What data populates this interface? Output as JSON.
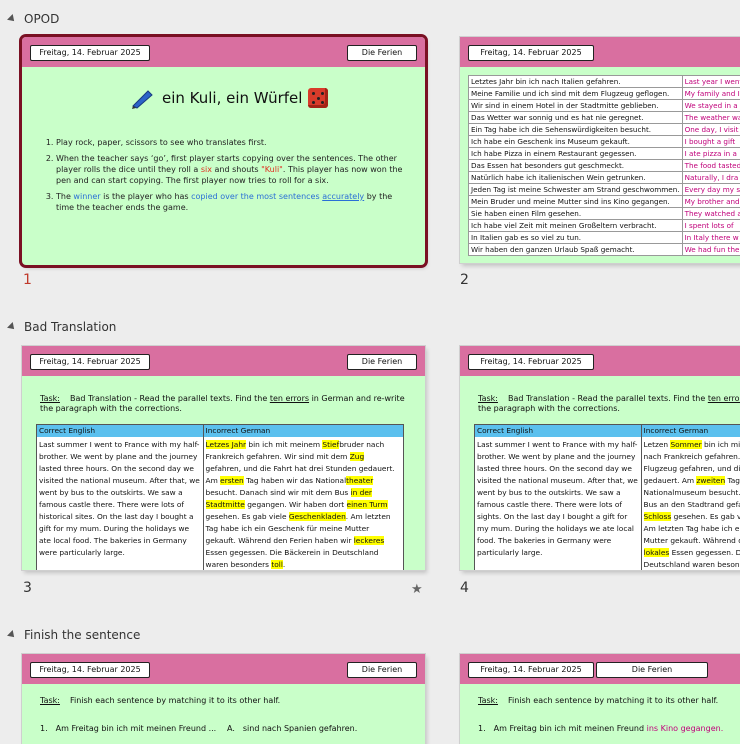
{
  "sections": [
    {
      "title": "OPOD"
    },
    {
      "title": "Bad Translation"
    },
    {
      "title": "Finish the sentence"
    }
  ],
  "header": {
    "date": "Freitag, 14. Februar 2025",
    "topic": "Die Ferien"
  },
  "slide1": {
    "number": "1",
    "title": "ein Kuli, ein Würfel",
    "rule1": "Play rock, paper, scissors to see who translates first.",
    "rule2a": "When the teacher says ‘go’, first player starts copying over the sentences. The other player rolls the dice until they roll a ",
    "rule2six": "six",
    "rule2b": " and shouts ",
    "rule2kuli": "\"Kuli\"",
    "rule2c": ". This player has now won the pen and can start copying. The first player now tries to roll for a six.",
    "rule3a": "The ",
    "rule3winner": "winner",
    "rule3b": " is the player who has ",
    "rule3copied": "copied over the most sentences",
    "rule3acc": "accurately",
    "rule3c": " by the time the teacher ends the game."
  },
  "slide2": {
    "number": "2",
    "rows": [
      [
        "Letztes Jahr bin ich nach Italien gefahren.",
        "Last year I went"
      ],
      [
        "Meine Familie und ich sind mit dem Flugzeug geflogen.",
        "My family and I"
      ],
      [
        "Wir sind in einem Hotel in der Stadtmitte geblieben.",
        "We stayed in a h"
      ],
      [
        "Das Wetter war sonnig und es hat nie geregnet.",
        "The weather was"
      ],
      [
        "Ein Tag habe ich die Sehenswürdigkeiten besucht.",
        "One day, I visit"
      ],
      [
        "Ich habe ein Geschenk ins Museum gekauft.",
        "I bought a gift"
      ],
      [
        "Ich habe Pizza in einem Restaurant gegessen.",
        "I ate pizza in a"
      ],
      [
        "Das Essen hat besonders gut geschmeckt.",
        "The food tasted"
      ],
      [
        "Natürlich habe ich italienischen Wein getrunken.",
        "Naturally, I dra"
      ],
      [
        "Jeden Tag ist meine Schwester am Strand geschwommen.",
        "Every day my sis"
      ],
      [
        "Mein Bruder und meine Mutter sind ins Kino gegangen.",
        "My brother and m"
      ],
      [
        "Sie haben einen Film gesehen.",
        "They watched a f"
      ],
      [
        "Ich habe viel Zeit mit meinen Großeltern verbracht.",
        "I spent lots of"
      ],
      [
        "In Italien gab es so viel zu tun.",
        "In Italy there w"
      ],
      [
        "Wir haben den ganzen Urlaub Spaß gemacht.",
        "We had fun the w"
      ]
    ]
  },
  "slide3": {
    "number": "3",
    "star": "★",
    "task_label": "Task:",
    "task_a": "Bad Translation - Read the parallel texts. Find the ",
    "task_errors": "ten errors",
    "task_b": " in German and re-write the paragraph with the corrections.",
    "col_en": "Correct English",
    "col_de": "Incorrect German",
    "english": "Last summer I went to France with my half-brother. We went by plane and the journey lasted three hours. On the second day we visited the national museum. After that, we went by bus to the outskirts. We saw a famous castle there. There were lots of historical sites. On the last day I bought a gift for my mum. During the holidays we ate local food. The bakeries in Germany were particularly large.",
    "de": [
      {
        "t": "Letzes Jahr",
        "h": true
      },
      {
        "t": " bin ich mit meinem "
      },
      {
        "t": "Stief",
        "h": true
      },
      {
        "t": "bruder nach Frankreich gefahren. Wir sind mit dem "
      },
      {
        "t": "Zug",
        "h": true
      },
      {
        "t": " gefahren, und die Fahrt hat drei Stunden gedauert. Am "
      },
      {
        "t": "ersten",
        "h": true
      },
      {
        "t": " Tag haben wir das National"
      },
      {
        "t": "theater",
        "h": true
      },
      {
        "t": " besucht. Danach sind wir mit dem Bus "
      },
      {
        "t": "in der Stadtmitte",
        "h": true
      },
      {
        "t": " gegangen. Wir haben dort "
      },
      {
        "t": "einen Turm",
        "h": true
      },
      {
        "t": " gesehen. Es gab viele "
      },
      {
        "t": "Geschenkladen",
        "h": true
      },
      {
        "t": ". Am letzten Tag habe ich ein Geschenk für meine Mutter gekauft. Während den Ferien haben wir "
      },
      {
        "t": "leckeres",
        "h": true
      },
      {
        "t": " Essen gegessen. Die Bäckerein in Deutschland waren besonders "
      },
      {
        "t": "toll",
        "h": true
      },
      {
        "t": "."
      }
    ]
  },
  "slide4": {
    "number": "4",
    "task_label": "Task:",
    "task_a": "Bad Translation - Read the parallel texts. Find the ",
    "task_errors": "ten errors",
    "task_b": " in German and re-write the paragraph with the corrections.",
    "col_en": "Correct English",
    "col_de": "Incorrect German",
    "english": "Last summer I went to France with my half-brother. We went by plane and the journey lasted three hours. On the second day we visited the national museum. After that, we went by bus to the outskirts. We saw a famous castle there. There were lots of sights. On the last day I bought a gift for my mum. During the holidays we ate local food. The bakeries in Germany were particularly large.",
    "de": [
      {
        "t": "Letzen "
      },
      {
        "t": "Sommer",
        "h": true
      },
      {
        "t": " bin ich mit meinem Halbbruder nach Frankreich gefahren. Wir sind mit dem Flugzeug gefahren, und die Fahrt hat drei Stunden gedauert. Am "
      },
      {
        "t": "zweiten",
        "h": true
      },
      {
        "t": " Tag haben wir das Nationalmuseum besucht. Danach sind wir mit dem Bus an den Stadtrand gefahren. Wir haben dort "
      },
      {
        "t": "ein Schloss",
        "h": true
      },
      {
        "t": " gesehen. Es gab viele "
      },
      {
        "t": "Sehenswürdigkeiten",
        "h": true
      },
      {
        "t": ". Am letzten Tag habe ich ein Geschenk für meine Mutter gekauft. Während den Ferien haben wir "
      },
      {
        "t": "lokales",
        "h": true
      },
      {
        "t": " Essen gegessen. Die Bäckerein in Deutschland waren besonders groß."
      }
    ]
  },
  "slide5": {
    "task_label": "Task:",
    "task": "Finish each sentence by matching it to its other half.",
    "item_no": "1.",
    "item": "Am Freitag bin ich mit meinen Freund ...",
    "opt_no": "A.",
    "opt": "sind nach Spanien gefahren."
  },
  "slide6": {
    "task_label": "Task:",
    "task": "Finish each sentence by matching it to its other half.",
    "item_no": "1.",
    "item": "Am Freitag bin ich mit meinen Freund ",
    "item_hl": "ins Kino gegangen."
  }
}
